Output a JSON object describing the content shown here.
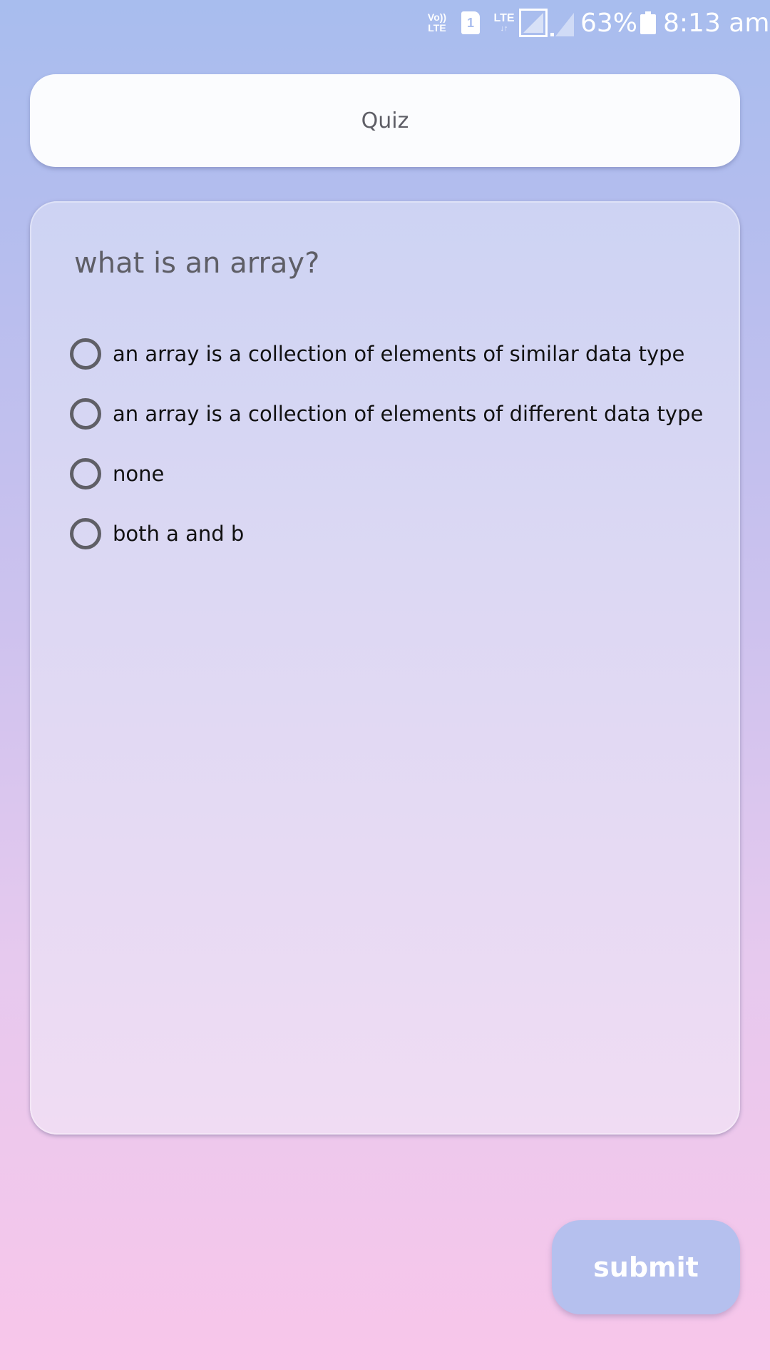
{
  "status_bar": {
    "volte_top": "Vo))",
    "volte_bottom": "LTE",
    "sim_slot": "1",
    "network": "LTE",
    "network_arrows": "↓↑",
    "battery_percent": "63%",
    "time": "8:13 am",
    "icons": [
      "volte-icon",
      "sim-icon",
      "lte-icon",
      "signal-icon",
      "signal-icon",
      "battery-icon"
    ]
  },
  "header": {
    "title": "Quiz"
  },
  "question": {
    "text": "what is an array?",
    "options": [
      {
        "label": "an array is a collection of elements of similar data type",
        "selected": false
      },
      {
        "label": "an array is a collection of elements of different data type",
        "selected": false
      },
      {
        "label": "none",
        "selected": false
      },
      {
        "label": "both a and b",
        "selected": false
      }
    ]
  },
  "actions": {
    "submit_label": "submit"
  },
  "colors": {
    "background_top": "#a8bdee",
    "background_bottom": "#f8c6ea",
    "card": "#fbfcfe",
    "submit_button": "#b5c0ee",
    "radio_border": "#5f5f66"
  }
}
